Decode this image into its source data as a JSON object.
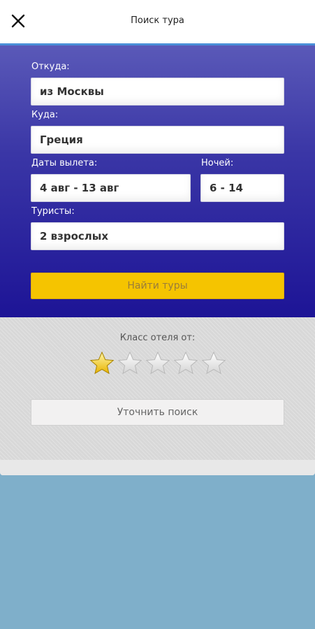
{
  "header": {
    "title": "Поиск тура"
  },
  "form": {
    "from_label": "Откуда:",
    "from_value": "из Москвы",
    "to_label": "Куда:",
    "to_value": "Греция",
    "dates_label": "Даты вылета:",
    "dates_value": "4 авг - 13 авг",
    "nights_label": "Ночей:",
    "nights_value": "6 - 14",
    "tourists_label": "Туристы:",
    "tourists_value": "2 взрослых",
    "find_button": "Найти туры"
  },
  "filters": {
    "hotel_class_label": "Класс отеля от:",
    "selected_stars": 1,
    "total_stars": 5,
    "refine_button": "Уточнить поиск"
  },
  "colors": {
    "accent_yellow": "#f5c400",
    "panel_blue": "#1d1496",
    "background": "#7fafca"
  }
}
